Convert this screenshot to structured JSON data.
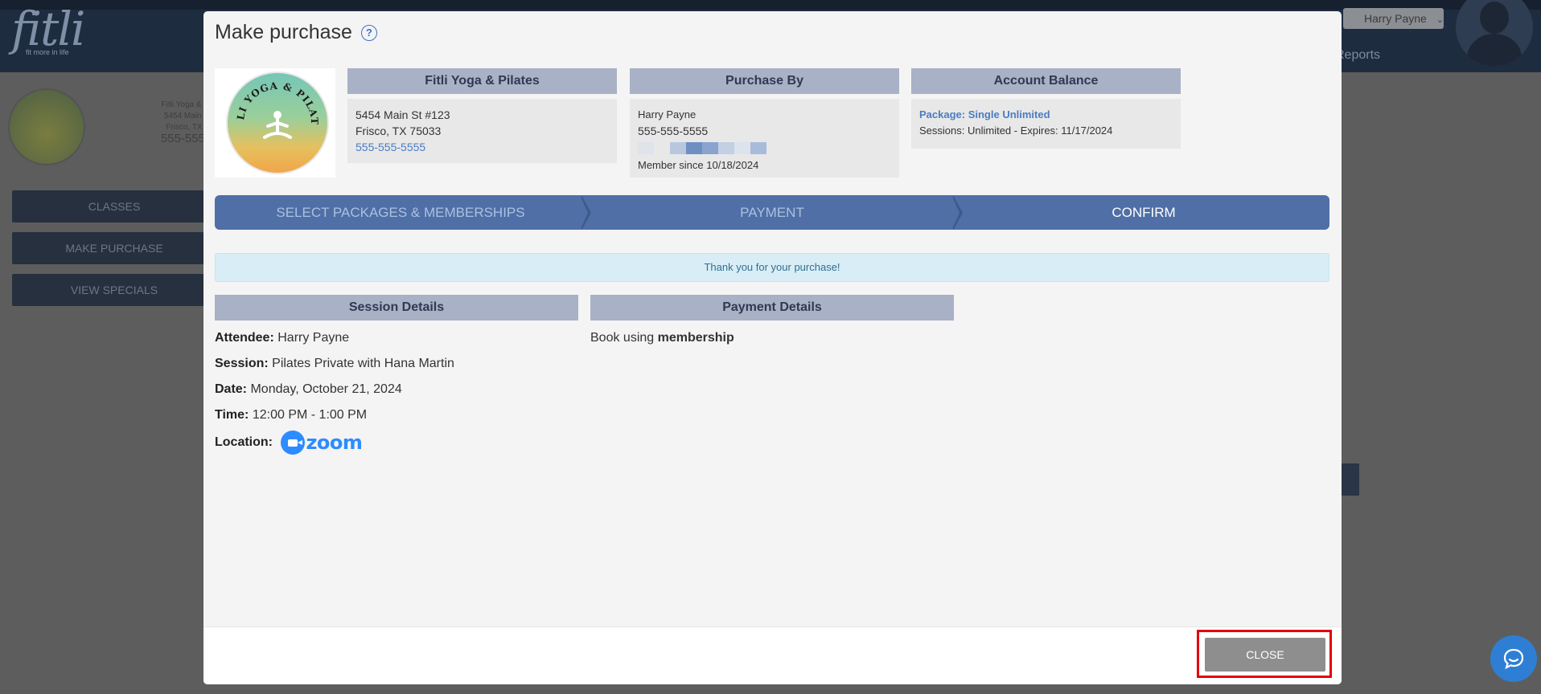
{
  "background": {
    "brand": {
      "logo_text": "fitli",
      "tagline": "fit more in life"
    },
    "user_menu_label": "Harry Payne",
    "reports_link": "Reports",
    "studio": {
      "line1": "Fitli Yoga & P",
      "line2": "5454 Main S",
      "line3": "Frisco, TX 7",
      "phone": "555-555-"
    },
    "nav": [
      "CLASSES",
      "MAKE PURCHASE",
      "VIEW SPECIALS"
    ]
  },
  "modal": {
    "title": "Make purchase",
    "help_icon": "question-circle-icon",
    "studio_logo_text": "FITLI YOGA & PILATES",
    "studio_card": {
      "header": "Fitli Yoga & Pilates",
      "address1": "5454 Main St #123",
      "address2": "Frisco, TX 75033",
      "phone": "555-555-5555"
    },
    "purchase_by": {
      "header": "Purchase By",
      "name": "Harry Payne",
      "phone": "555-555-5555",
      "member_since": "Member since 10/18/2024"
    },
    "account_balance": {
      "header": "Account Balance",
      "package": "Package: Single Unlimited",
      "sessions": "Sessions: Unlimited -  Expires: 11/17/2024"
    },
    "steps": [
      "SELECT PACKAGES & MEMBERSHIPS",
      "PAYMENT",
      "CONFIRM"
    ],
    "active_step": 2,
    "alert": "Thank you for your purchase!",
    "session_details": {
      "header": "Session Details",
      "attendee_label": "Attendee:",
      "attendee": "Harry Payne",
      "session_label": "Session:",
      "session": "Pilates Private with Hana Martin",
      "date_label": "Date:",
      "date": "Monday, October 21, 2024",
      "time_label": "Time:",
      "time": "12:00 PM - 1:00 PM",
      "location_label": "Location:",
      "location_logo": "zoom"
    },
    "payment_details": {
      "header": "Payment Details",
      "prefix": "Book using",
      "method": "membership"
    },
    "close_label": "CLOSE"
  },
  "colors": {
    "accent": "#4f6fa6",
    "header_gray": "#a9b1c7",
    "highlight": "#e3000f",
    "link": "#4a7cc2"
  }
}
